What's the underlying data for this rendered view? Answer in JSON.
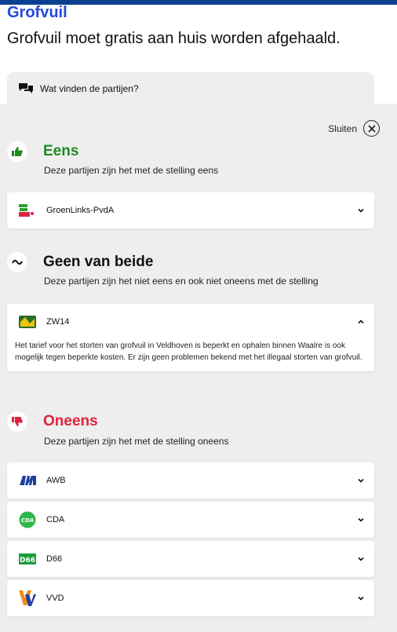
{
  "header": {
    "title": "Grofvuil",
    "statement": "Grofvuil moet gratis aan huis worden afgehaald."
  },
  "parties_toggle": {
    "label": "Wat vinden de partijen?"
  },
  "close": {
    "label": "Sluiten"
  },
  "colors": {
    "agree": "#1f8a1f",
    "disagree": "#e0223f",
    "title_blue": "#2548e0"
  },
  "sections": {
    "eens": {
      "title": "Eens",
      "subtitle": "Deze partijen zijn het met de stelling eens",
      "icon": "thumbs-up-icon"
    },
    "geen": {
      "title": "Geen van beide",
      "subtitle": "Deze partijen zijn het niet eens en ook niet oneens met de stelling",
      "icon": "tilde-icon"
    },
    "oneens": {
      "title": "Oneens",
      "subtitle": "Deze partijen zijn het met de stelling oneens",
      "icon": "thumbs-down-icon"
    }
  },
  "parties": {
    "gl_pvda": {
      "name": "GroenLinks-PvdA"
    },
    "zw14": {
      "name": "ZW14",
      "explanation": "Het tarief voor het storten van grofvuil in Veldhoven is beperkt en ophalen binnen Waalre is ook mogelijk tegen beperkte kosten. Er zijn geen problemen bekend met het illegaal storten van grofvuil."
    },
    "awb": {
      "name": "AWB"
    },
    "cda": {
      "name": "CDA"
    },
    "d66": {
      "name": "D66"
    },
    "vvd": {
      "name": "VVD"
    }
  }
}
